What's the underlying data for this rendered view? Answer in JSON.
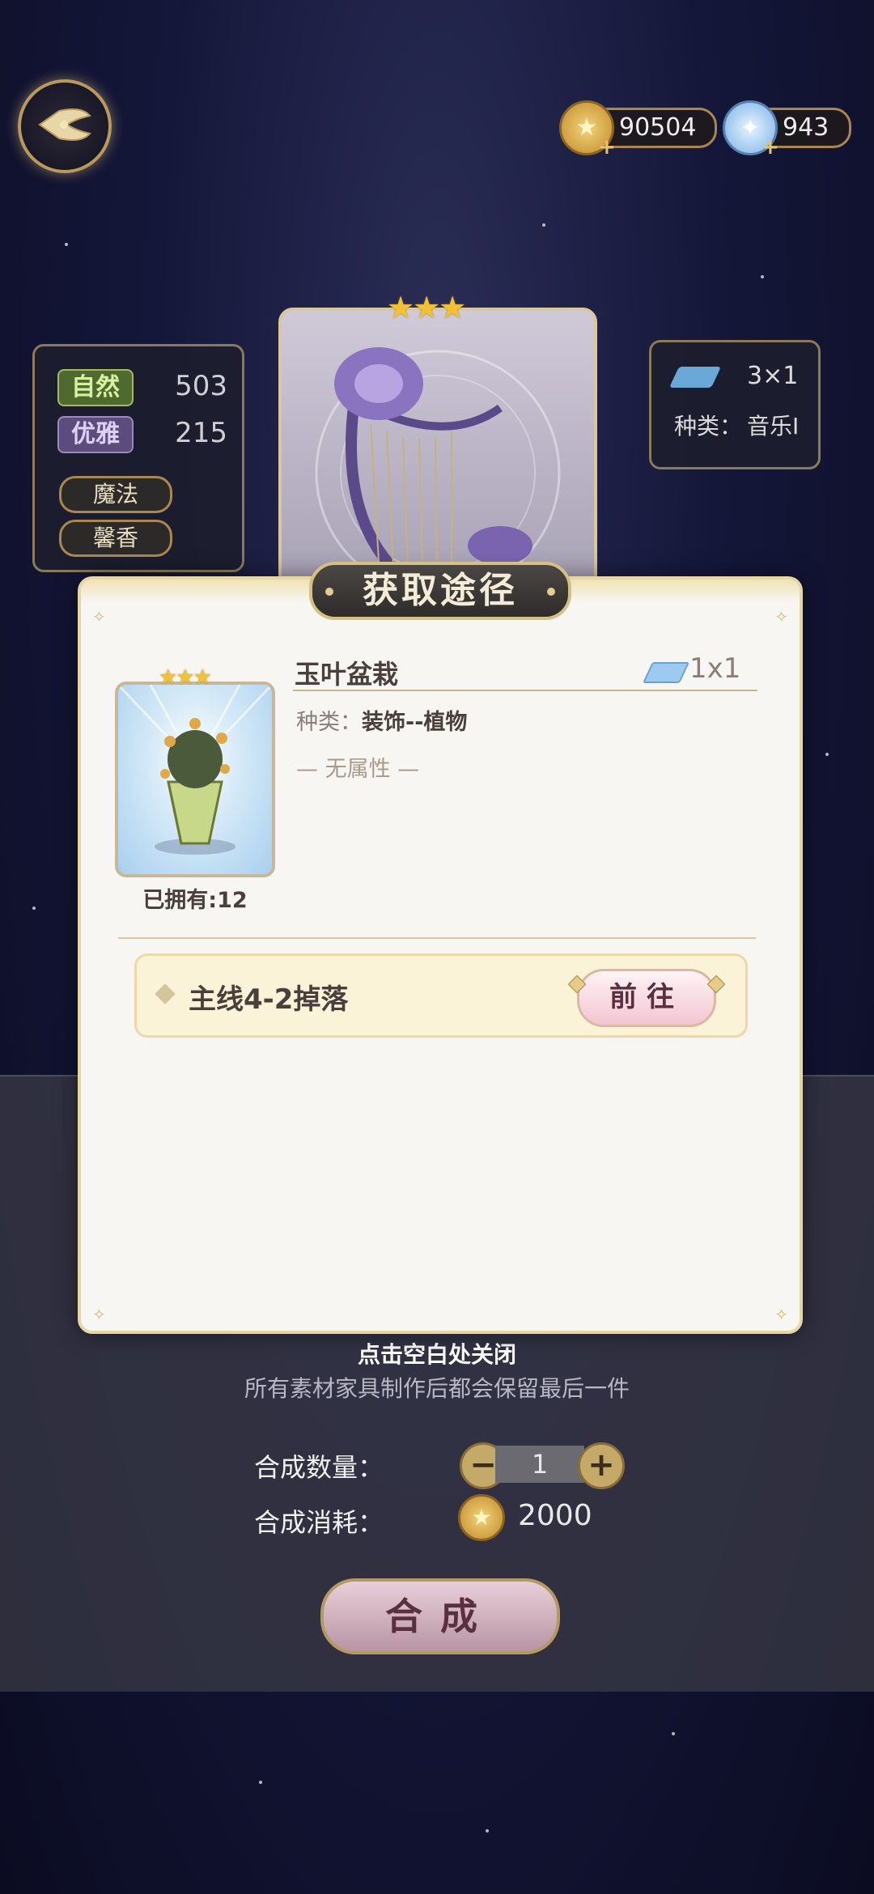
{
  "hud": {
    "coins": "90504",
    "gems": "943"
  },
  "attributes": {
    "natural_label": "自然",
    "natural_value": "503",
    "elegant_label": "优雅",
    "elegant_value": "215",
    "tag_magic": "魔法",
    "tag_fragrance": "馨香"
  },
  "background_item": {
    "size": "3×1",
    "type_label": "种类：",
    "type_value": "音乐I",
    "stars": "★★★"
  },
  "modal": {
    "title": "获取途径",
    "item_name": "玉叶盆栽",
    "item_size": "1x1",
    "type_prefix": "种类：",
    "type_value": "装饰--植物",
    "attribute": "— 无属性 —",
    "stars": "★★★",
    "owned": "已拥有:12",
    "source_text": "主线4-2掉落",
    "go_button": "前往"
  },
  "bottom": {
    "close_hint": "点击空白处关闭",
    "keep_hint": "所有素材家具制作后都会保留最后一件",
    "qty_label": "合成数量：",
    "qty_value": "1",
    "minus": "−",
    "plus": "+",
    "cost_label": "合成消耗：",
    "cost_value": "2000",
    "craft_button": "合成"
  },
  "colors": {
    "accent_gold": "#d6bf82",
    "modal_bg": "#f8f6f2",
    "button_pink": "#f2c5d2"
  }
}
